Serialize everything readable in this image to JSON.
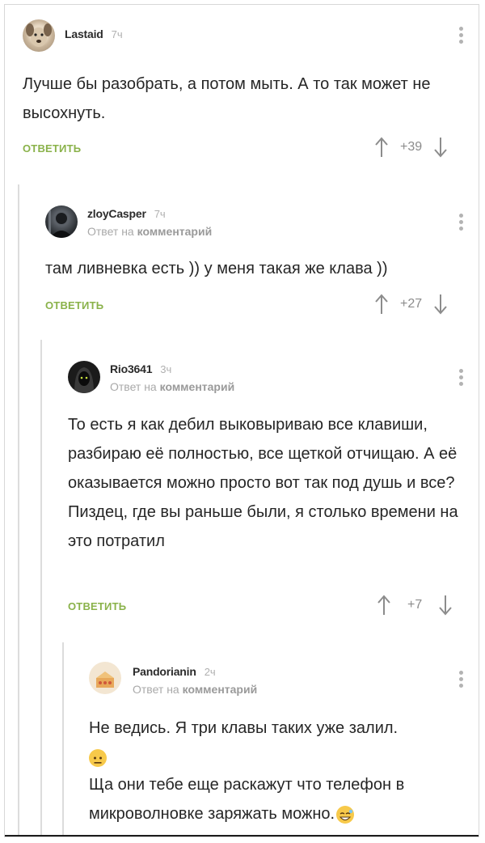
{
  "comments": [
    {
      "author": "Lastaid",
      "time": "7ч",
      "text": "Лучше бы разобрать, а потом мыть. А то так может не высохнуть.",
      "reply_label": "ОТВЕТИТЬ",
      "score": "+39"
    },
    {
      "author": "zloyCasper",
      "time": "7ч",
      "reply_to_prefix": "Ответ на",
      "reply_to_target": "комментарий",
      "text": "там ливневка есть )) у меня такая же клава ))",
      "reply_label": "ОТВЕТИТЬ",
      "score": "+27"
    },
    {
      "author": "Rio3641",
      "time": "3ч",
      "reply_to_prefix": "Ответ на",
      "reply_to_target": "комментарий",
      "text": "То есть я как дебил выковыриваю все клавиши, разбираю её полностью, все щеткой отчищаю. А её оказывается можно просто вот так под душь и все? Пиздец, где вы раньше были, я столько времени на это потратил",
      "reply_label": "ОТВЕТИТЬ",
      "score": "+7"
    },
    {
      "author": "Pandorianin",
      "time": "2ч",
      "reply_to_prefix": "Ответ на",
      "reply_to_target": "комментарий",
      "text_line1": "Не ведись. Я три клавы таких уже залил.",
      "text_line2": "Ща они тебе еще раскажут что телефон в микроволновке заряжать можно."
    }
  ],
  "colors": {
    "reply_green": "#8ab24a",
    "meta_gray": "#a9a9a9",
    "thread_line": "#dcdcdc"
  },
  "icons": [
    "more-vertical-icon",
    "arrow-up-icon",
    "arrow-down-icon",
    "neutral-face-emoji",
    "grinning-sweat-emoji"
  ]
}
